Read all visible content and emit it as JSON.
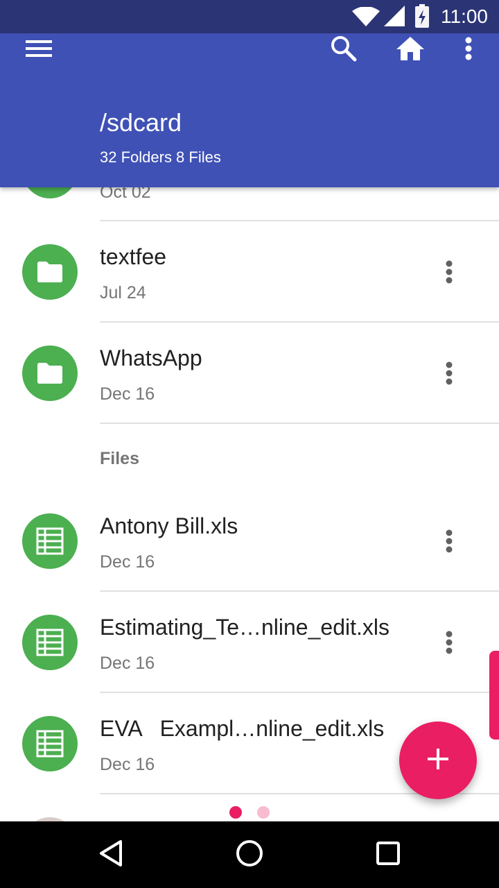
{
  "status_bar": {
    "time": "11:00",
    "icons": [
      "wifi-icon",
      "cell-signal-icon",
      "battery-charging-icon"
    ]
  },
  "toolbar": {
    "menu_icon": "menu-icon",
    "search_icon": "search-icon",
    "home_icon": "home-icon",
    "overflow_icon": "more-vert-icon"
  },
  "header": {
    "path": "/sdcard",
    "summary": "32 Folders 8 Files"
  },
  "folders": [
    {
      "name": "",
      "date": "Oct 02",
      "icon": "folder-icon"
    },
    {
      "name": "textfee",
      "date": "Jul 24",
      "icon": "folder-icon"
    },
    {
      "name": "WhatsApp",
      "date": "Dec 16",
      "icon": "folder-icon"
    }
  ],
  "files_section_label": "Files",
  "files": [
    {
      "name": "Antony Bill.xls",
      "date": "Dec 16",
      "icon": "spreadsheet-icon"
    },
    {
      "name": "Estimating_Te…nline_edit.xls",
      "date": "Dec 16",
      "icon": "spreadsheet-icon"
    },
    {
      "name": "EVA   Exampl…nline_edit.xls",
      "date": "Dec 16",
      "icon": "spreadsheet-icon"
    }
  ],
  "fab": {
    "icon": "add-icon"
  },
  "colors": {
    "primary": "#3f51b5",
    "primary_dark": "#2b3575",
    "accent": "#e91e63",
    "avatar_green": "#4caf50"
  },
  "nav_bar": {
    "buttons": [
      "back-icon",
      "home-circle-icon",
      "recents-icon"
    ]
  }
}
